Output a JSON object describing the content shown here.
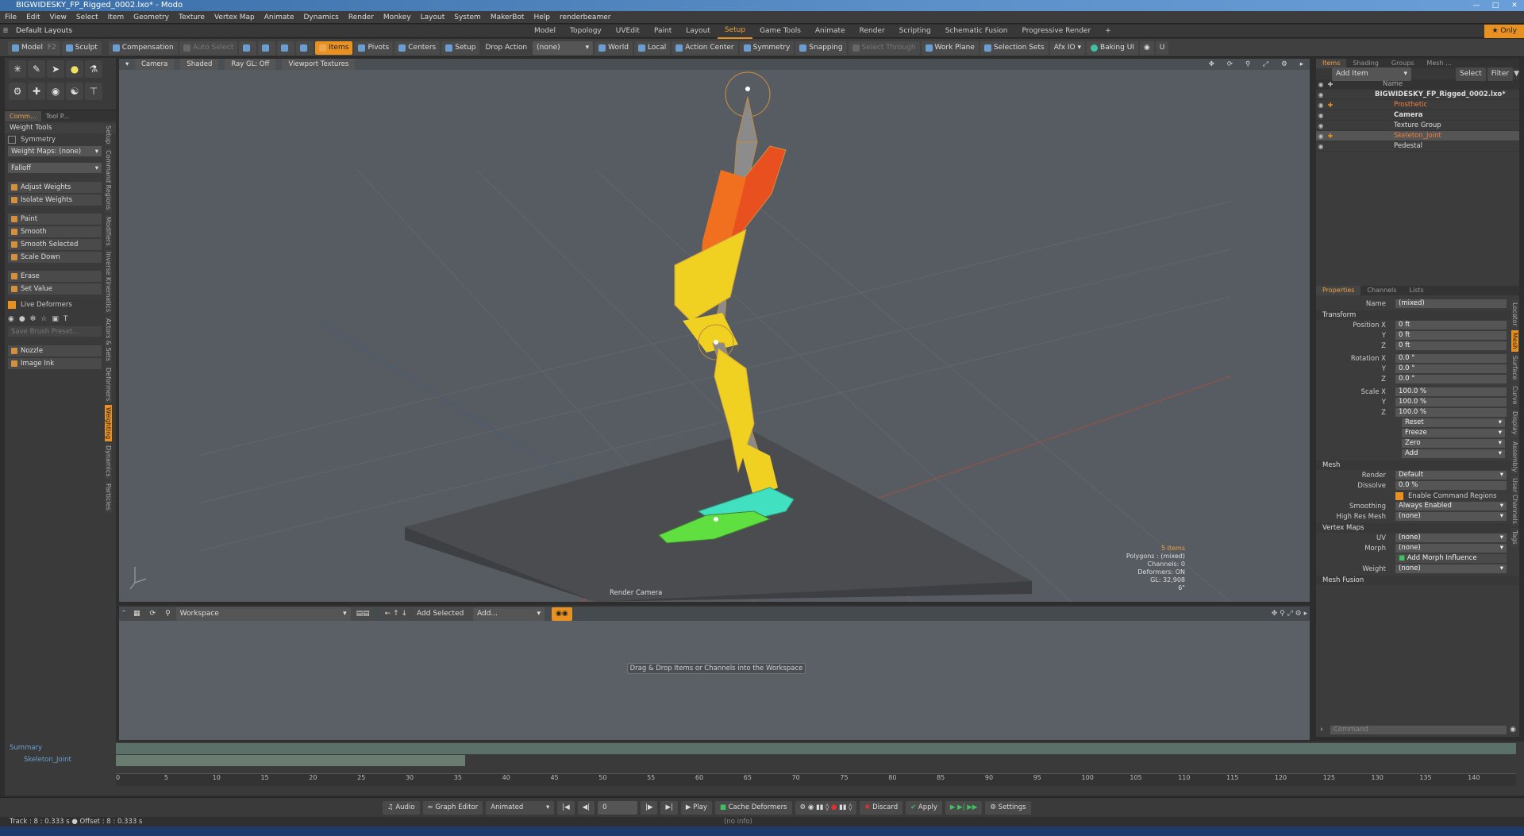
{
  "window": {
    "title": "BIGWIDESKY_FP_Rigged_0002.lxo* - Modo"
  },
  "menu": [
    "File",
    "Edit",
    "View",
    "Select",
    "Item",
    "Geometry",
    "Texture",
    "Vertex Map",
    "Animate",
    "Dynamics",
    "Render",
    "Monkey",
    "Layout",
    "System",
    "MakerBot",
    "Help",
    "renderbeamer"
  ],
  "layout": {
    "selector": "Default Layouts",
    "tabs": [
      "Model",
      "Topology",
      "UVEdit",
      "Paint",
      "Layout",
      "Setup",
      "Game Tools",
      "Animate",
      "Render",
      "Scripting",
      "Schematic Fusion",
      "Progressive Render"
    ],
    "active_tab": "Setup",
    "only_label": "Only"
  },
  "toolbar": {
    "model": "Model",
    "model_key": "F2",
    "sculpt": "Sculpt",
    "compensation": "Compensation",
    "auto_select": "Auto Select",
    "items": "Items",
    "pivots": "Pivots",
    "centers": "Centers",
    "setup": "Setup",
    "drop_action": "Drop Action",
    "drop_value": "(none)",
    "world": "World",
    "local": "Local",
    "action_center": "Action Center",
    "symmetry": "Symmetry",
    "snapping": "Snapping",
    "select_through": "Select Through",
    "work_plane": "Work Plane",
    "selection_sets": "Selection Sets",
    "afx": "Afx IO",
    "baking": "Baking UI"
  },
  "left": {
    "tabs": [
      "Comm...",
      "Tool P..."
    ],
    "header": "Weight Tools",
    "symmetry": "Symmetry",
    "weight_maps": "Weight Maps: (none)",
    "falloff": "Falloff",
    "buttons1": [
      "Adjust Weights",
      "Isolate Weights"
    ],
    "buttons2": [
      "Paint",
      "Smooth",
      "Smooth Selected",
      "Scale Down"
    ],
    "buttons3": [
      "Erase",
      "Set Value"
    ],
    "live_deformers": "Live Deformers",
    "brush_preset": "Save Brush Preset...",
    "buttons4": [
      "Nozzle",
      "Image Ink"
    ],
    "vtabs": [
      "Setup",
      "Command Regions",
      "Modifiers",
      "Inverse Kinematics",
      "Actors & Sets",
      "Deformers",
      "Weighting",
      "Dynamics",
      "Particles"
    ],
    "active_vtab": "Weighting"
  },
  "viewport": {
    "camera": "Camera",
    "shading": "Shaded",
    "ray_gl": "Ray GL: Off",
    "textures": "Viewport Textures",
    "render_camera": "Render Camera",
    "stats": {
      "items": "5 Items",
      "polygons": "Polygons : (mixed)",
      "channels": "Channels: 0",
      "deformers": "Deformers: ON",
      "gl": "GL: 32,908",
      "unit": "6\""
    }
  },
  "workspace": {
    "selector": "Workspace",
    "add_selected": "Add Selected",
    "add": "Add...",
    "message": "Drag & Drop Items or Channels into the Workspace"
  },
  "items_panel": {
    "tabs": [
      "Items",
      "Shading",
      "Groups",
      "Mesh ..."
    ],
    "add_item": "Add Item",
    "select": "Select",
    "filter": "Filter",
    "col_name": "Name",
    "rows": [
      {
        "name": "BIGWIDESKY_FP_Rigged_0002.lxo*",
        "indent": 0
      },
      {
        "name": "Prosthetic",
        "indent": 1
      },
      {
        "name": "Camera",
        "indent": 1
      },
      {
        "name": "Texture Group",
        "indent": 1
      },
      {
        "name": "Skeleton_Joint",
        "indent": 1
      },
      {
        "name": "Pedestal",
        "indent": 1
      }
    ]
  },
  "props": {
    "tabs": [
      "Properties",
      "Channels",
      "Lists"
    ],
    "name_label": "Name",
    "name_value": "(mixed)",
    "transform": "Transform",
    "position": [
      {
        "l": "Position X",
        "v": "0 ft"
      },
      {
        "l": "Y",
        "v": "0 ft"
      },
      {
        "l": "Z",
        "v": "0 ft"
      }
    ],
    "rotation": [
      {
        "l": "Rotation X",
        "v": "0.0 °"
      },
      {
        "l": "Y",
        "v": "0.0 °"
      },
      {
        "l": "Z",
        "v": "0.0 °"
      }
    ],
    "scale": [
      {
        "l": "Scale X",
        "v": "100.0 %"
      },
      {
        "l": "Y",
        "v": "100.0 %"
      },
      {
        "l": "Z",
        "v": "100.0 %"
      }
    ],
    "actions": [
      "Reset",
      "Freeze",
      "Zero",
      "Add"
    ],
    "mesh": "Mesh",
    "render_label": "Render",
    "render_value": "Default",
    "dissolve_label": "Dissolve",
    "dissolve_value": "0.0 %",
    "cmd_regions": "Enable Command Regions",
    "smoothing_label": "Smoothing",
    "smoothing_value": "Always Enabled",
    "hires_label": "High Res Mesh",
    "hires_value": "(none)",
    "vmaps": "Vertex Maps",
    "uv_label": "UV",
    "uv_value": "(none)",
    "morph_label": "Morph",
    "morph_value": "(none)",
    "morph_btn": "Add Morph Influence",
    "weight_label": "Weight",
    "weight_value": "(none)",
    "mesh_fusion": "Mesh Fusion",
    "vtabs": [
      "Locator",
      "Mesh",
      "Surface",
      "Curve",
      "Display",
      "Assembly",
      "User Channels",
      "Tags"
    ],
    "command": "Command"
  },
  "timeline": {
    "summary": "Summary",
    "joint": "Skeleton_Joint",
    "ticks": [
      "0",
      "5",
      "10",
      "15",
      "20",
      "25",
      "30",
      "35",
      "40",
      "45",
      "50",
      "55",
      "60",
      "65",
      "70",
      "75",
      "80",
      "85",
      "90",
      "95",
      "100",
      "105",
      "110",
      "115",
      "120",
      "125",
      "130",
      "135",
      "140"
    ]
  },
  "transport": {
    "audio": "Audio",
    "graph": "Graph Editor",
    "animated": "Animated",
    "frame": "0",
    "play": "Play",
    "cache": "Cache Deformers",
    "discard": "Discard",
    "apply": "Apply",
    "settings": "Settings"
  },
  "status": {
    "track": "Track : 8 : 0.333 s ● Offset : 8 : 0.333 s",
    "info": "(no info)"
  },
  "colors": {
    "accent": "#e89020",
    "viewport": "#555b60"
  }
}
